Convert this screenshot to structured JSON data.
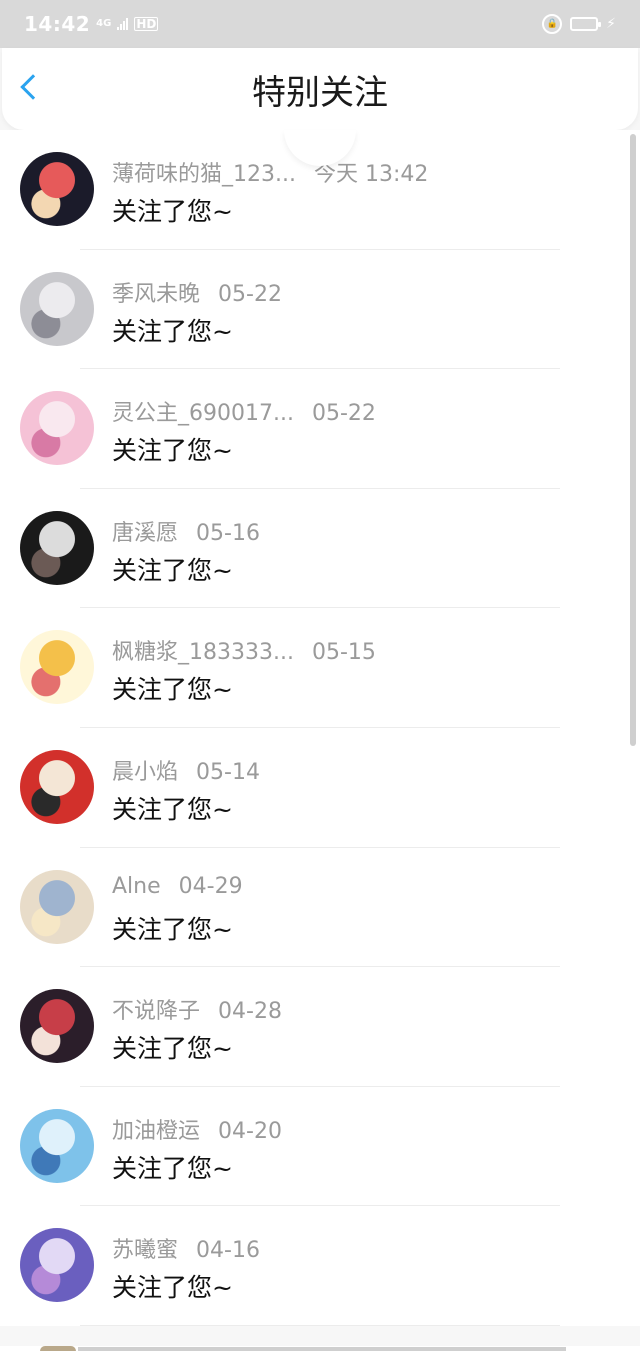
{
  "status_bar": {
    "time": "14:42",
    "network": "4G",
    "hd": "HD"
  },
  "header": {
    "title": "特别关注"
  },
  "follows": [
    {
      "name": "薄荷味的猫_123...",
      "date": "今天 13:42",
      "message": "关注了您~",
      "avatar_colors": [
        "#1b1b2a",
        "#e65a5a",
        "#f3d7b2"
      ]
    },
    {
      "name": "季风未晚",
      "date": "05-22",
      "message": "关注了您~",
      "avatar_colors": [
        "#c8c8cc",
        "#ecebee",
        "#8d8d96"
      ]
    },
    {
      "name": "灵公主_690017...",
      "date": "05-22",
      "message": "关注了您~",
      "avatar_colors": [
        "#f5c2d6",
        "#f9e8ef",
        "#d87aa5"
      ]
    },
    {
      "name": "唐溪愿",
      "date": "05-16",
      "message": "关注了您~",
      "avatar_colors": [
        "#1a1a1a",
        "#dcdcdc",
        "#6b5a55"
      ]
    },
    {
      "name": "枫糖浆_183333...",
      "date": "05-15",
      "message": "关注了您~",
      "avatar_colors": [
        "#fff7d9",
        "#f4c04a",
        "#e4706e"
      ]
    },
    {
      "name": "晨小焰",
      "date": "05-14",
      "message": "关注了您~",
      "avatar_colors": [
        "#d2302b",
        "#f4e6d6",
        "#2a2a2a"
      ]
    },
    {
      "name": "Alne",
      "date": "04-29",
      "message": "关注了您~",
      "avatar_colors": [
        "#e8dcc9",
        "#9fb4cf",
        "#f6e7c6"
      ]
    },
    {
      "name": "不说降子",
      "date": "04-28",
      "message": "关注了您~",
      "avatar_colors": [
        "#2b1e2a",
        "#c73e48",
        "#f3e2d9"
      ]
    },
    {
      "name": "加油橙运",
      "date": "04-20",
      "message": "关注了您~",
      "avatar_colors": [
        "#7ec2ea",
        "#dff1fb",
        "#3f79b8"
      ]
    },
    {
      "name": "苏曦蜜",
      "date": "04-16",
      "message": "关注了您~",
      "avatar_colors": [
        "#6a5fbf",
        "#e2d9f5",
        "#b58ad8"
      ]
    }
  ],
  "colors": {
    "accent": "#2aa3ef",
    "name_text": "#9a9a9a",
    "message_text": "#111111"
  }
}
